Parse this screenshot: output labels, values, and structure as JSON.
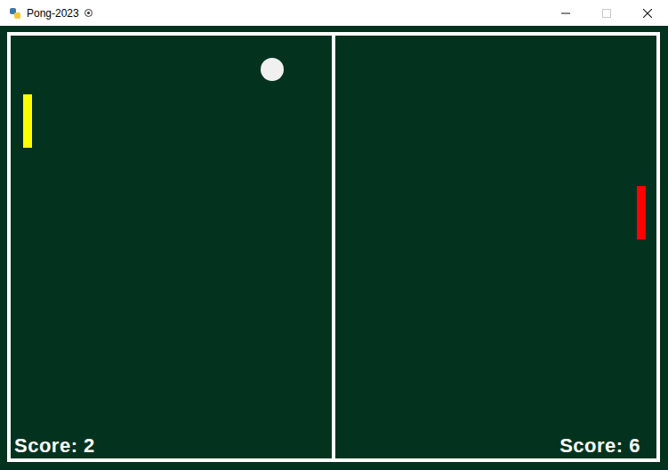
{
  "window": {
    "title": "Pong-2023",
    "controls": [
      {
        "kind": "minimize",
        "disabled": false
      },
      {
        "kind": "maximize",
        "disabled": true
      },
      {
        "kind": "close",
        "disabled": false
      }
    ]
  },
  "players": [
    {
      "side": "left",
      "score": "Score: 2",
      "color": "#ffff00"
    },
    {
      "side": "right",
      "score": "Score: 6",
      "color": "#ff0000"
    }
  ]
}
